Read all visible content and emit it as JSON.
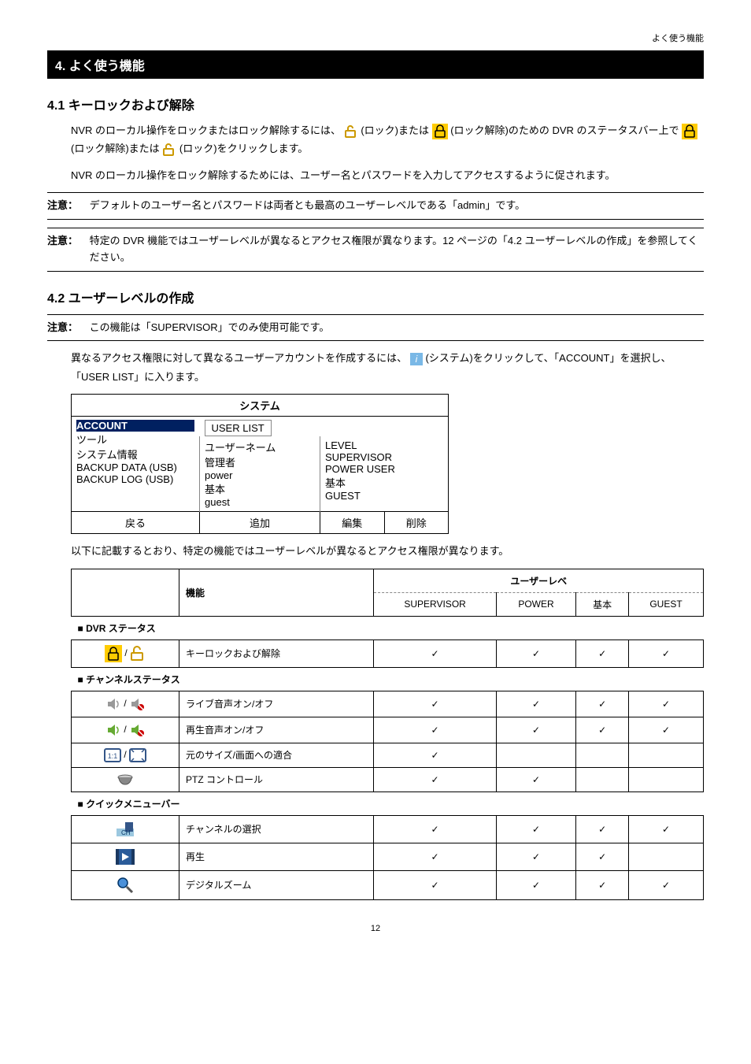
{
  "header": {
    "right": "よく使う機能"
  },
  "title_bar": "4. よく使う機能",
  "s41": {
    "heading": "4.1 キーロックおよび解除",
    "p1a": "NVR のローカル操作をロックまたはロック解除するには、",
    "p1b": " (ロック)または ",
    "p1c": " (ロック解除)のための DVR のステータスバー上で ",
    "p1d": " (ロック解除)または ",
    "p1e": " (ロック)をクリックします。",
    "p2": "NVR のローカル操作をロック解除するためには、ユーザー名とパスワードを入力してアクセスするように促されます。",
    "note1_label": "注意：",
    "note1_text": "デフォルトのユーザー名とパスワードは両者とも最高のユーザーレベルである「admin」です。",
    "note2_label": "注意：",
    "note2_text": "特定の DVR 機能ではユーザーレベルが異なるとアクセス権限が異なります。12 ページの「4.2 ユーザーレベルの作成」を参照してください。"
  },
  "s42": {
    "heading": "4.2 ユーザーレベルの作成",
    "note_label": "注意：",
    "note_text": "この機能は「SUPERVISOR」でのみ使用可能です。",
    "p1a": "異なるアクセス権限に対して異なるユーザーアカウントを作成するには、",
    "p1b": " (システム)をクリックして、「ACCOUNT」を選択し、「USER LIST」に入ります。",
    "system": {
      "title": "システム",
      "left": [
        "ACCOUNT",
        "ツール",
        "システム情報",
        "BACKUP DATA (USB)",
        "BACKUP LOG (USB)"
      ],
      "userlist": "USER LIST",
      "col_user": [
        "ユーザーネーム",
        "管理者",
        "power",
        "基本",
        "guest"
      ],
      "col_level_h": "LEVEL",
      "col_level": [
        "SUPERVISOR",
        "POWER USER",
        "基本",
        "GUEST"
      ],
      "back": "戻る",
      "add": "追加",
      "edit": "編集",
      "delete": "削除"
    },
    "p2": "以下に記載するとおり、特定の機能ではユーザーレベルが異なるとアクセス権限が異なります。",
    "table": {
      "h_func": "機能",
      "h_level": "ユーザーレベ",
      "h_sup": "SUPERVISOR",
      "h_pow": "POWER",
      "h_basic": "基本",
      "h_guest": "GUEST",
      "sec_dvr": "■ DVR ステータス",
      "r1": "キーロックおよび解除",
      "sec_ch": "■ チャンネルステータス",
      "r2": "ライブ音声オン/オフ",
      "r3": "再生音声オン/オフ",
      "r4": "元のサイズ/画面への適合",
      "r5": "PTZ コントロール",
      "sec_qm": "■ クイックメニューバー",
      "r6": "チャンネルの選択",
      "r7": "再生",
      "r8": "デジタルズーム"
    }
  },
  "footer": "12"
}
